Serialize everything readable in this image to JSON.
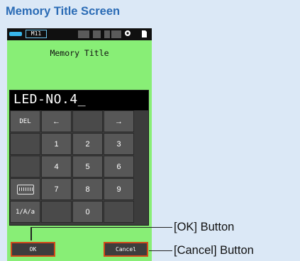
{
  "heading": "Memory Title Screen",
  "statusbar": {
    "memory_label": "M11",
    "battery_icon": "battery-icon",
    "wireless_icon": "wireless-icon",
    "file_icon": "file-icon"
  },
  "screen_title": "Memory Title",
  "entry_text": "LED-NO.4_",
  "keypad": {
    "del": "DEL",
    "left": "←",
    "right": "→",
    "digits": [
      "1",
      "2",
      "3",
      "4",
      "5",
      "6",
      "7",
      "8",
      "9",
      "0"
    ],
    "keyboard_icon": "keyboard-icon",
    "case_toggle": "1/A/a"
  },
  "buttons": {
    "ok": "OK",
    "cancel": "Cancel"
  },
  "callouts": {
    "ok": "[OK] Button",
    "cancel": "[Cancel] Button"
  },
  "colors": {
    "heading": "#2a6bb5",
    "screen_bg": "#88ee76",
    "accent_border": "#d24a1a",
    "battery": "#39b6ea"
  }
}
